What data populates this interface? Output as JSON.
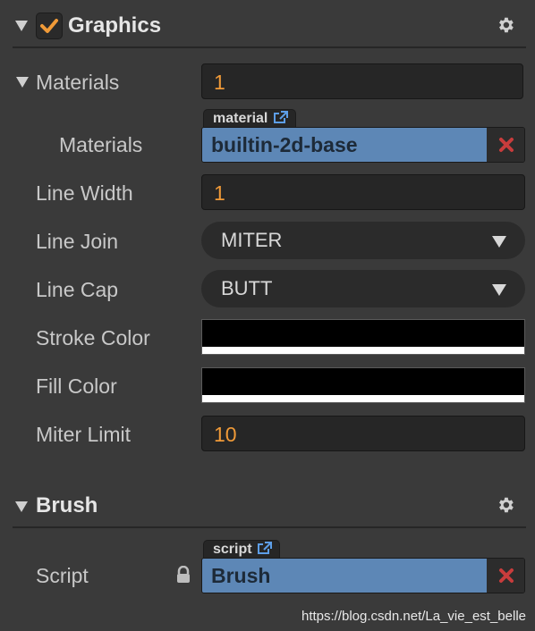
{
  "graphics": {
    "title": "Graphics",
    "enabled": true,
    "properties": {
      "materials_label": "Materials",
      "materials_count": "1",
      "material_item_label": "Materials",
      "material_tag": "material",
      "material_value": "builtin-2d-base",
      "line_width_label": "Line Width",
      "line_width_value": "1",
      "line_join_label": "Line Join",
      "line_join_value": "MITER",
      "line_cap_label": "Line Cap",
      "line_cap_value": "BUTT",
      "stroke_color_label": "Stroke Color",
      "stroke_color_value": "#000000",
      "fill_color_label": "Fill Color",
      "fill_color_value": "#000000",
      "miter_limit_label": "Miter Limit",
      "miter_limit_value": "10"
    }
  },
  "brush": {
    "title": "Brush",
    "script_label": "Script",
    "script_tag": "script",
    "script_value": "Brush"
  },
  "watermark": "https://blog.csdn.net/La_vie_est_belle",
  "colors": {
    "panel_bg": "#3a3a3a",
    "field_bg": "#262626",
    "number_text": "#f09a38",
    "asset_blue": "#5d87b6",
    "check_orange": "#f09a38",
    "remove_red": "#c83c3c"
  },
  "icons": {
    "collapse": "triangle-down-icon",
    "settings": "gear-icon",
    "checkbox": "checkmark-icon",
    "open_asset": "external-link-icon",
    "remove": "x-icon",
    "lock": "lock-icon",
    "dropdown": "caret-down-icon"
  }
}
